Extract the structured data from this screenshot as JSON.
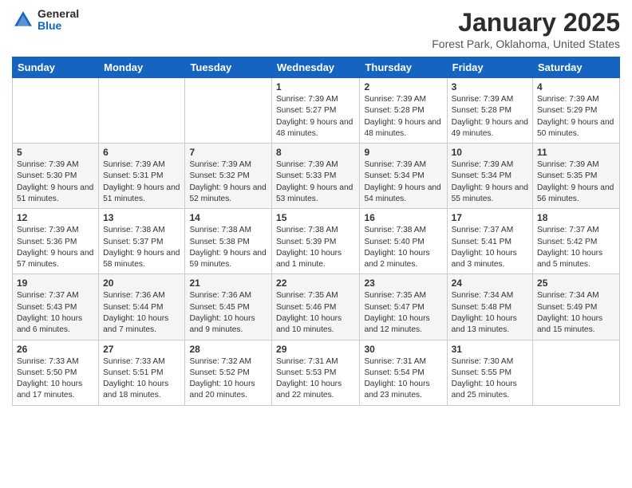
{
  "header": {
    "logo": {
      "general": "General",
      "blue": "Blue"
    },
    "title": "January 2025",
    "location": "Forest Park, Oklahoma, United States"
  },
  "calendar": {
    "days_of_week": [
      "Sunday",
      "Monday",
      "Tuesday",
      "Wednesday",
      "Thursday",
      "Friday",
      "Saturday"
    ],
    "weeks": [
      [
        {
          "day": "",
          "info": ""
        },
        {
          "day": "",
          "info": ""
        },
        {
          "day": "",
          "info": ""
        },
        {
          "day": "1",
          "info": "Sunrise: 7:39 AM\nSunset: 5:27 PM\nDaylight: 9 hours and 48 minutes."
        },
        {
          "day": "2",
          "info": "Sunrise: 7:39 AM\nSunset: 5:28 PM\nDaylight: 9 hours and 48 minutes."
        },
        {
          "day": "3",
          "info": "Sunrise: 7:39 AM\nSunset: 5:28 PM\nDaylight: 9 hours and 49 minutes."
        },
        {
          "day": "4",
          "info": "Sunrise: 7:39 AM\nSunset: 5:29 PM\nDaylight: 9 hours and 50 minutes."
        }
      ],
      [
        {
          "day": "5",
          "info": "Sunrise: 7:39 AM\nSunset: 5:30 PM\nDaylight: 9 hours and 51 minutes."
        },
        {
          "day": "6",
          "info": "Sunrise: 7:39 AM\nSunset: 5:31 PM\nDaylight: 9 hours and 51 minutes."
        },
        {
          "day": "7",
          "info": "Sunrise: 7:39 AM\nSunset: 5:32 PM\nDaylight: 9 hours and 52 minutes."
        },
        {
          "day": "8",
          "info": "Sunrise: 7:39 AM\nSunset: 5:33 PM\nDaylight: 9 hours and 53 minutes."
        },
        {
          "day": "9",
          "info": "Sunrise: 7:39 AM\nSunset: 5:34 PM\nDaylight: 9 hours and 54 minutes."
        },
        {
          "day": "10",
          "info": "Sunrise: 7:39 AM\nSunset: 5:34 PM\nDaylight: 9 hours and 55 minutes."
        },
        {
          "day": "11",
          "info": "Sunrise: 7:39 AM\nSunset: 5:35 PM\nDaylight: 9 hours and 56 minutes."
        }
      ],
      [
        {
          "day": "12",
          "info": "Sunrise: 7:39 AM\nSunset: 5:36 PM\nDaylight: 9 hours and 57 minutes."
        },
        {
          "day": "13",
          "info": "Sunrise: 7:38 AM\nSunset: 5:37 PM\nDaylight: 9 hours and 58 minutes."
        },
        {
          "day": "14",
          "info": "Sunrise: 7:38 AM\nSunset: 5:38 PM\nDaylight: 9 hours and 59 minutes."
        },
        {
          "day": "15",
          "info": "Sunrise: 7:38 AM\nSunset: 5:39 PM\nDaylight: 10 hours and 1 minute."
        },
        {
          "day": "16",
          "info": "Sunrise: 7:38 AM\nSunset: 5:40 PM\nDaylight: 10 hours and 2 minutes."
        },
        {
          "day": "17",
          "info": "Sunrise: 7:37 AM\nSunset: 5:41 PM\nDaylight: 10 hours and 3 minutes."
        },
        {
          "day": "18",
          "info": "Sunrise: 7:37 AM\nSunset: 5:42 PM\nDaylight: 10 hours and 5 minutes."
        }
      ],
      [
        {
          "day": "19",
          "info": "Sunrise: 7:37 AM\nSunset: 5:43 PM\nDaylight: 10 hours and 6 minutes."
        },
        {
          "day": "20",
          "info": "Sunrise: 7:36 AM\nSunset: 5:44 PM\nDaylight: 10 hours and 7 minutes."
        },
        {
          "day": "21",
          "info": "Sunrise: 7:36 AM\nSunset: 5:45 PM\nDaylight: 10 hours and 9 minutes."
        },
        {
          "day": "22",
          "info": "Sunrise: 7:35 AM\nSunset: 5:46 PM\nDaylight: 10 hours and 10 minutes."
        },
        {
          "day": "23",
          "info": "Sunrise: 7:35 AM\nSunset: 5:47 PM\nDaylight: 10 hours and 12 minutes."
        },
        {
          "day": "24",
          "info": "Sunrise: 7:34 AM\nSunset: 5:48 PM\nDaylight: 10 hours and 13 minutes."
        },
        {
          "day": "25",
          "info": "Sunrise: 7:34 AM\nSunset: 5:49 PM\nDaylight: 10 hours and 15 minutes."
        }
      ],
      [
        {
          "day": "26",
          "info": "Sunrise: 7:33 AM\nSunset: 5:50 PM\nDaylight: 10 hours and 17 minutes."
        },
        {
          "day": "27",
          "info": "Sunrise: 7:33 AM\nSunset: 5:51 PM\nDaylight: 10 hours and 18 minutes."
        },
        {
          "day": "28",
          "info": "Sunrise: 7:32 AM\nSunset: 5:52 PM\nDaylight: 10 hours and 20 minutes."
        },
        {
          "day": "29",
          "info": "Sunrise: 7:31 AM\nSunset: 5:53 PM\nDaylight: 10 hours and 22 minutes."
        },
        {
          "day": "30",
          "info": "Sunrise: 7:31 AM\nSunset: 5:54 PM\nDaylight: 10 hours and 23 minutes."
        },
        {
          "day": "31",
          "info": "Sunrise: 7:30 AM\nSunset: 5:55 PM\nDaylight: 10 hours and 25 minutes."
        },
        {
          "day": "",
          "info": ""
        }
      ]
    ]
  }
}
